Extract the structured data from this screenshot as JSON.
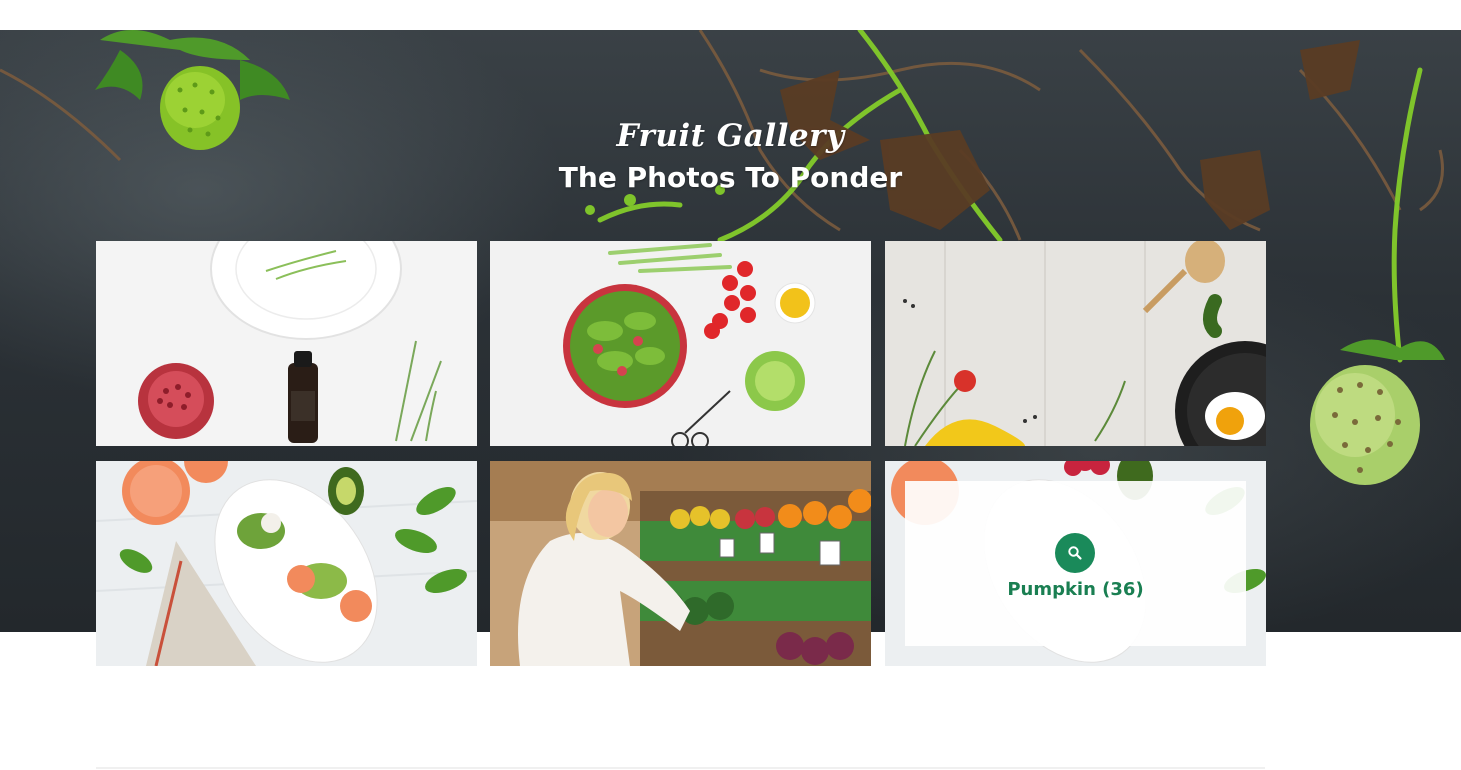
{
  "hero": {
    "subtitle": "Fruit Gallery",
    "title": "The Photos To Ponder"
  },
  "gallery": {
    "tiles": [
      {
        "theme": "pomegranate-plate-bottle"
      },
      {
        "theme": "salad-bowl-tomatoes"
      },
      {
        "theme": "wooden-board-pan-egg"
      },
      {
        "theme": "grapefruit-avocado-platter"
      },
      {
        "theme": "woman-shopping-produce"
      },
      {
        "theme": "platter-with-hover-overlay"
      }
    ],
    "hover": {
      "title": "Pumpkin (36)",
      "icon": "search-icon"
    }
  },
  "colors": {
    "accent": "#1a8a5a",
    "accent_text": "#1a7f52",
    "hero_bg": "#2b3136"
  }
}
